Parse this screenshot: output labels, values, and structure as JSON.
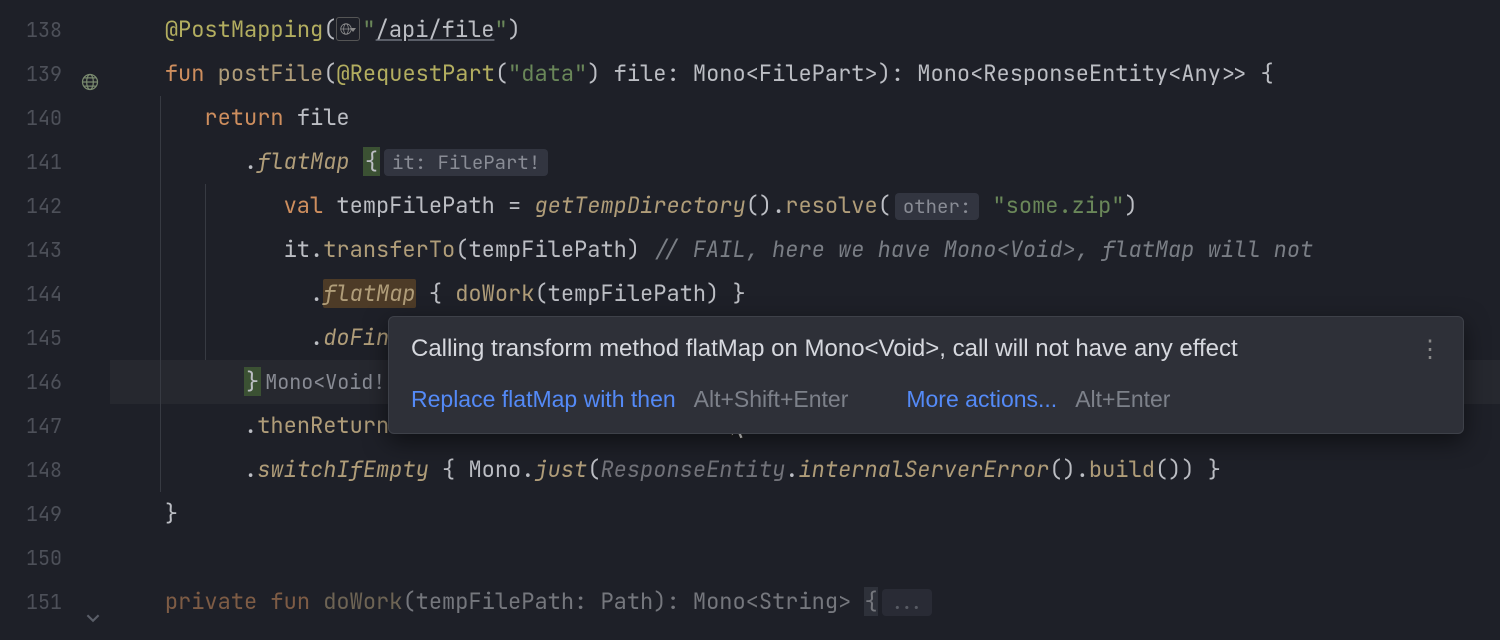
{
  "gutter": {
    "lines": [
      "138",
      "139",
      "140",
      "141",
      "142",
      "143",
      "144",
      "145",
      "146",
      "147",
      "148",
      "149",
      "150",
      "151"
    ]
  },
  "code": {
    "l138": {
      "annotation": "@PostMapping",
      "url": "/api/file"
    },
    "l139": {
      "kw_fun": "fun",
      "fn": "postFile",
      "anno": "@RequestPart",
      "str_data": "\"data\"",
      "param": "file",
      "type1": "Mono<FilePart>",
      "type2": "Mono<ResponseEntity<Any>>"
    },
    "l140": {
      "kw_return": "return",
      "id": "file"
    },
    "l141": {
      "dot": ".",
      "fn": "flatMap",
      "brace": "{",
      "hint": "it: FilePart!"
    },
    "l142": {
      "kw_val": "val",
      "id": "tempFilePath",
      "eq": " = ",
      "fn1": "getTempDirectory",
      "fn2": "resolve",
      "hint": "other:",
      "str": "\"some.zip\""
    },
    "l143": {
      "id": "it",
      "fn": "transferTo",
      "arg": "tempFilePath",
      "comment": "// FAIL, here we have Mono<Void>, flatMap will not"
    },
    "l144": {
      "dot": ".",
      "fn": "flatMap",
      "brace_l": "{",
      "fn2": "doWork",
      "arg": "tempFilePath",
      "brace_r": "}"
    },
    "l145": {
      "dot": ".",
      "fn": "doFina"
    },
    "l146": {
      "brace": "}",
      "hint": "Mono<Void!"
    },
    "l147": {
      "dot": ".",
      "fn": "thenReturn"
    },
    "l148": {
      "dot": ".",
      "fn": "switchIfEmpty",
      "brace_l": "{",
      "cls": "Mono",
      "fn2": "just",
      "cls2": "ResponseEntity",
      "fn3": "internalServerError",
      "fn4": "build",
      "brace_r": "}"
    },
    "l149": {
      "brace": "}"
    },
    "l151": {
      "kw_private": "private",
      "kw_fun": "fun",
      "fn": "doWork",
      "param": "tempFilePath",
      "type": "Path",
      "ret": "Mono<String>",
      "brace": "{"
    }
  },
  "tooltip": {
    "message": "Calling transform method flatMap on Mono<Void>, call will not have any effect",
    "menu_dots": "⋮",
    "action1": "Replace flatMap with then",
    "action1_kbd": "Alt+Shift+Enter",
    "action2": "More actions...",
    "action2_kbd": "Alt+Enter"
  }
}
